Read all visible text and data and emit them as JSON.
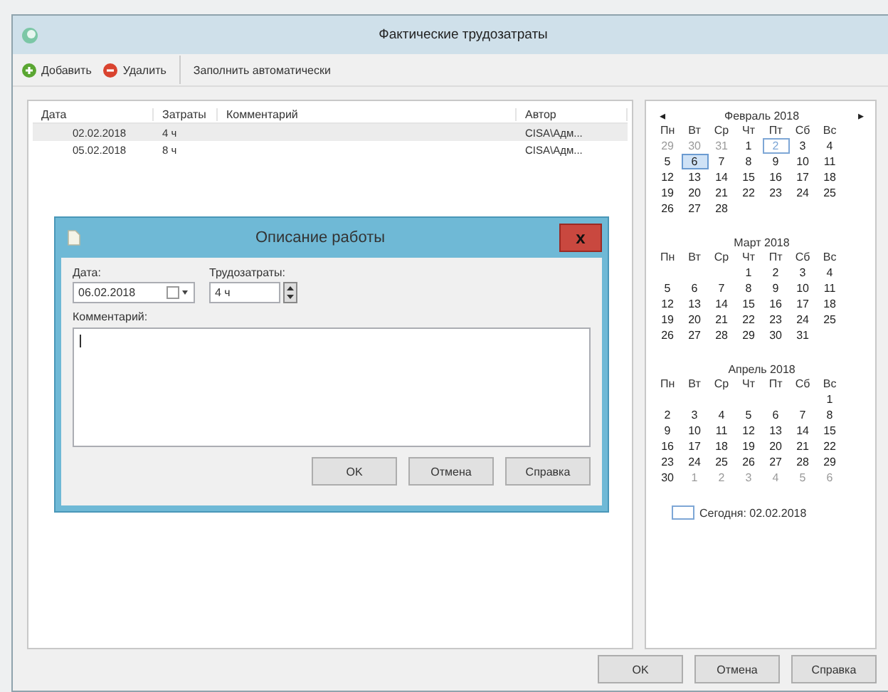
{
  "window": {
    "title": "Фактические трудозатраты"
  },
  "toolbar": [
    {
      "label": "Добавить",
      "kind": "add"
    },
    {
      "label": "Удалить",
      "kind": "remove"
    },
    {
      "label": "Заполнить автоматически",
      "kind": "plain"
    }
  ],
  "table": {
    "columns": [
      "Дата",
      "Затраты",
      "Комментарий",
      "Автор"
    ],
    "rows": [
      {
        "cells": [
          "02.02.2018",
          "4 ч",
          "",
          "CISA\\Адм..."
        ],
        "selected": true
      },
      {
        "cells": [
          "05.02.2018",
          "8 ч",
          "",
          "CISA\\Адм..."
        ],
        "selected": false
      }
    ]
  },
  "calendar": {
    "prev": "◂",
    "next": "▸",
    "today_label": "Сегодня: 02.02.2018",
    "months": [
      {
        "title": "Февраль 2018",
        "weekdays": [
          "Пн",
          "Вт",
          "Ср",
          "Чт",
          "Пт",
          "Сб",
          "Вс"
        ],
        "days": [
          {
            "text": "29",
            "kind": "other"
          },
          {
            "text": "30",
            "kind": "other"
          },
          {
            "text": "31",
            "kind": "other"
          },
          {
            "text": "1",
            "kind": "day"
          },
          {
            "text": "2",
            "kind": "today"
          },
          {
            "text": "3",
            "kind": "day"
          },
          {
            "text": "4",
            "kind": "day"
          },
          {
            "text": "5",
            "kind": "day"
          },
          {
            "text": "6",
            "kind": "selected"
          },
          {
            "text": "7",
            "kind": "day"
          },
          {
            "text": "8",
            "kind": "day"
          },
          {
            "text": "9",
            "kind": "day"
          },
          {
            "text": "10",
            "kind": "day"
          },
          {
            "text": "11",
            "kind": "day"
          },
          {
            "text": "12",
            "kind": "day"
          },
          {
            "text": "13",
            "kind": "day"
          },
          {
            "text": "14",
            "kind": "day"
          },
          {
            "text": "15",
            "kind": "day"
          },
          {
            "text": "16",
            "kind": "day"
          },
          {
            "text": "17",
            "kind": "day"
          },
          {
            "text": "18",
            "kind": "day"
          },
          {
            "text": "19",
            "kind": "day"
          },
          {
            "text": "20",
            "kind": "day"
          },
          {
            "text": "21",
            "kind": "day"
          },
          {
            "text": "22",
            "kind": "day"
          },
          {
            "text": "23",
            "kind": "day"
          },
          {
            "text": "24",
            "kind": "day"
          },
          {
            "text": "25",
            "kind": "day"
          },
          {
            "text": "26",
            "kind": "day"
          },
          {
            "text": "27",
            "kind": "day"
          },
          {
            "text": "28",
            "kind": "day"
          }
        ]
      },
      {
        "title": "Март 2018",
        "weekdays": [
          "Пн",
          "Вт",
          "Ср",
          "Чт",
          "Пт",
          "Сб",
          "Вс"
        ],
        "days": [
          {
            "kind": "pad"
          },
          {
            "kind": "pad"
          },
          {
            "kind": "pad"
          },
          {
            "text": "1",
            "kind": "day"
          },
          {
            "text": "2",
            "kind": "day"
          },
          {
            "text": "3",
            "kind": "day"
          },
          {
            "text": "4",
            "kind": "day"
          },
          {
            "text": "5",
            "kind": "day"
          },
          {
            "text": "6",
            "kind": "day"
          },
          {
            "text": "7",
            "kind": "day"
          },
          {
            "text": "8",
            "kind": "day"
          },
          {
            "text": "9",
            "kind": "day"
          },
          {
            "text": "10",
            "kind": "day"
          },
          {
            "text": "11",
            "kind": "day"
          },
          {
            "text": "12",
            "kind": "day"
          },
          {
            "text": "13",
            "kind": "day"
          },
          {
            "text": "14",
            "kind": "day"
          },
          {
            "text": "15",
            "kind": "day"
          },
          {
            "text": "16",
            "kind": "day"
          },
          {
            "text": "17",
            "kind": "day"
          },
          {
            "text": "18",
            "kind": "day"
          },
          {
            "text": "19",
            "kind": "day"
          },
          {
            "text": "20",
            "kind": "day"
          },
          {
            "text": "21",
            "kind": "day"
          },
          {
            "text": "22",
            "kind": "day"
          },
          {
            "text": "23",
            "kind": "day"
          },
          {
            "text": "24",
            "kind": "day"
          },
          {
            "text": "25",
            "kind": "day"
          },
          {
            "text": "26",
            "kind": "day"
          },
          {
            "text": "27",
            "kind": "day"
          },
          {
            "text": "28",
            "kind": "day"
          },
          {
            "text": "29",
            "kind": "day"
          },
          {
            "text": "30",
            "kind": "day"
          },
          {
            "text": "31",
            "kind": "day"
          }
        ]
      },
      {
        "title": "Апрель 2018",
        "weekdays": [
          "Пн",
          "Вт",
          "Ср",
          "Чт",
          "Пт",
          "Сб",
          "Вс"
        ],
        "days": [
          {
            "kind": "pad"
          },
          {
            "kind": "pad"
          },
          {
            "kind": "pad"
          },
          {
            "kind": "pad"
          },
          {
            "kind": "pad"
          },
          {
            "kind": "pad"
          },
          {
            "text": "1",
            "kind": "day"
          },
          {
            "text": "2",
            "kind": "day"
          },
          {
            "text": "3",
            "kind": "day"
          },
          {
            "text": "4",
            "kind": "day"
          },
          {
            "text": "5",
            "kind": "day"
          },
          {
            "text": "6",
            "kind": "day"
          },
          {
            "text": "7",
            "kind": "day"
          },
          {
            "text": "8",
            "kind": "day"
          },
          {
            "text": "9",
            "kind": "day"
          },
          {
            "text": "10",
            "kind": "day"
          },
          {
            "text": "11",
            "kind": "day"
          },
          {
            "text": "12",
            "kind": "day"
          },
          {
            "text": "13",
            "kind": "day"
          },
          {
            "text": "14",
            "kind": "day"
          },
          {
            "text": "15",
            "kind": "day"
          },
          {
            "text": "16",
            "kind": "day"
          },
          {
            "text": "17",
            "kind": "day"
          },
          {
            "text": "18",
            "kind": "day"
          },
          {
            "text": "19",
            "kind": "day"
          },
          {
            "text": "20",
            "kind": "day"
          },
          {
            "text": "21",
            "kind": "day"
          },
          {
            "text": "22",
            "kind": "day"
          },
          {
            "text": "23",
            "kind": "day"
          },
          {
            "text": "24",
            "kind": "day"
          },
          {
            "text": "25",
            "kind": "day"
          },
          {
            "text": "26",
            "kind": "day"
          },
          {
            "text": "27",
            "kind": "day"
          },
          {
            "text": "28",
            "kind": "day"
          },
          {
            "text": "29",
            "kind": "day"
          },
          {
            "text": "30",
            "kind": "day"
          },
          {
            "text": "1",
            "kind": "other"
          },
          {
            "text": "2",
            "kind": "other"
          },
          {
            "text": "3",
            "kind": "other"
          },
          {
            "text": "4",
            "kind": "other"
          },
          {
            "text": "5",
            "kind": "other"
          },
          {
            "text": "6",
            "kind": "other"
          }
        ]
      }
    ]
  },
  "buttons": [
    "OK",
    "Отмена",
    "Справка"
  ],
  "dialog": {
    "title": "Описание работы",
    "close": "x",
    "date": {
      "label": "Дата:",
      "value": "06.02.2018"
    },
    "effort": {
      "label": "Трудозатраты:",
      "value": "4 ч"
    },
    "comment": {
      "label": "Комментарий:"
    },
    "buttons": [
      "OK",
      "Отмена",
      "Справка"
    ]
  }
}
